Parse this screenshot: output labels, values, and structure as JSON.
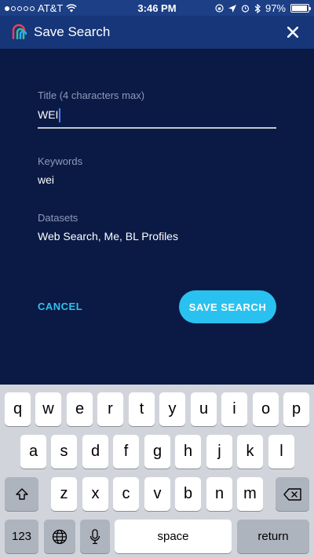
{
  "status_bar": {
    "carrier": "AT&T",
    "time": "3:46 PM",
    "battery": "97%",
    "battery_level": 0.97,
    "signal_bars": 1
  },
  "header": {
    "title": "Save Search",
    "close_icon": "close-icon"
  },
  "form": {
    "title_label": "Title (4 characters max)",
    "title_value": "WEI",
    "keywords_label": "Keywords",
    "keywords_value": "wei",
    "datasets_label": "Datasets",
    "datasets_value": "Web Search, Me, BL Profiles",
    "cancel_label": "CANCEL",
    "save_label": "SAVE SEARCH"
  },
  "keyboard": {
    "row1": [
      "q",
      "w",
      "e",
      "r",
      "t",
      "y",
      "u",
      "i",
      "o",
      "p"
    ],
    "row2": [
      "a",
      "s",
      "d",
      "f",
      "g",
      "h",
      "j",
      "k",
      "l"
    ],
    "row3": [
      "z",
      "x",
      "c",
      "v",
      "b",
      "n",
      "m"
    ],
    "numbers_label": "123",
    "space_label": "space",
    "return_label": "return"
  },
  "colors": {
    "background": "#0a1a45",
    "header": "#163679",
    "accent": "#29c2f0",
    "keyboard": "#d1d5db"
  }
}
